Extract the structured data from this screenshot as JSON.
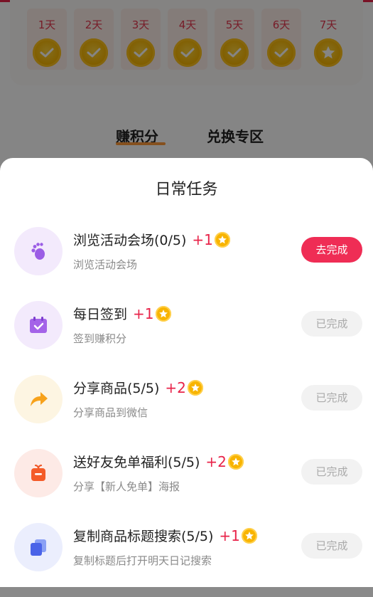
{
  "checkin": {
    "days": [
      {
        "label": "1天",
        "state": "done"
      },
      {
        "label": "2天",
        "state": "done"
      },
      {
        "label": "3天",
        "state": "done"
      },
      {
        "label": "4天",
        "state": "done"
      },
      {
        "label": "5天",
        "state": "done"
      },
      {
        "label": "6天",
        "state": "done"
      },
      {
        "label": "7天",
        "state": "star"
      }
    ]
  },
  "tabs": {
    "earn": "赚积分",
    "exchange": "兑换专区"
  },
  "sheet": {
    "title": "日常任务",
    "tasks": [
      {
        "title": "浏览活动会场(0/5)",
        "points": "+1",
        "subtitle": "浏览活动会场",
        "button": "去完成",
        "icon": "footprint-icon"
      },
      {
        "title": "每日签到",
        "points": "+1",
        "subtitle": "签到赚积分",
        "button": "已完成",
        "icon": "calendar-check-icon"
      },
      {
        "title": "分享商品(5/5)",
        "points": "+2",
        "subtitle": "分享商品到微信",
        "button": "已完成",
        "icon": "share-arrow-icon"
      },
      {
        "title": "送好友免单福利(5/5)",
        "points": "+2",
        "subtitle": "分享【新人免单】海报",
        "button": "已完成",
        "icon": "gift-box-icon"
      },
      {
        "title": "复制商品标题搜索(5/5)",
        "points": "+1",
        "subtitle": "复制标题后打开明天日记搜索",
        "button": "已完成",
        "icon": "copy-icon"
      }
    ]
  },
  "colors": {
    "accent": "#ef2d55",
    "points": "#e8244a",
    "coin": "#f8b400",
    "done_button_bg": "#f2f2f2"
  }
}
